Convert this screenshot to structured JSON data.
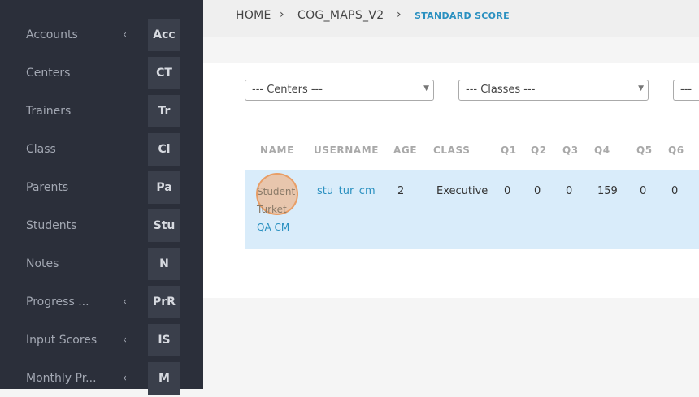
{
  "sidebar": {
    "items": [
      {
        "label": "Accounts",
        "abbr": "Acc",
        "chevron": "‹"
      },
      {
        "label": "Centers",
        "abbr": "CT",
        "chevron": ""
      },
      {
        "label": "Trainers",
        "abbr": "Tr",
        "chevron": ""
      },
      {
        "label": "Class",
        "abbr": "Cl",
        "chevron": ""
      },
      {
        "label": "Parents",
        "abbr": "Pa",
        "chevron": ""
      },
      {
        "label": "Students",
        "abbr": "Stu",
        "chevron": ""
      },
      {
        "label": "Notes",
        "abbr": "N",
        "chevron": ""
      },
      {
        "label": "Progress ...",
        "abbr": "PrR",
        "chevron": "‹"
      },
      {
        "label": "Input Scores",
        "abbr": "IS",
        "chevron": "‹"
      },
      {
        "label": "Monthly Pr...",
        "abbr": "M",
        "chevron": "‹"
      }
    ]
  },
  "breadcrumb": {
    "home": "HOME",
    "module": "COG_MAPS_V2",
    "current": "STANDARD SCORE",
    "separator": "›"
  },
  "filters": {
    "centers": "--- Centers ---",
    "classes": "--- Classes ---",
    "third": "---"
  },
  "table": {
    "headers": [
      "NAME",
      "USERNAME",
      "AGE",
      "CLASS",
      "Q1",
      "Q2",
      "Q3",
      "Q4",
      "Q5",
      "Q6"
    ],
    "row": {
      "name_line1": "Student",
      "name_line2": "Turket",
      "name_line3": "QA CM",
      "username": "stu_tur_cm",
      "age": "2",
      "class": "Executive",
      "q1": "0",
      "q2": "0",
      "q3": "0",
      "q4": "159",
      "q5": "0",
      "q6": "0"
    }
  },
  "colors": {
    "sidebar_bg": "#2b2f3a",
    "accent": "#2a90c0",
    "row_highlight": "#d9ecfa"
  }
}
